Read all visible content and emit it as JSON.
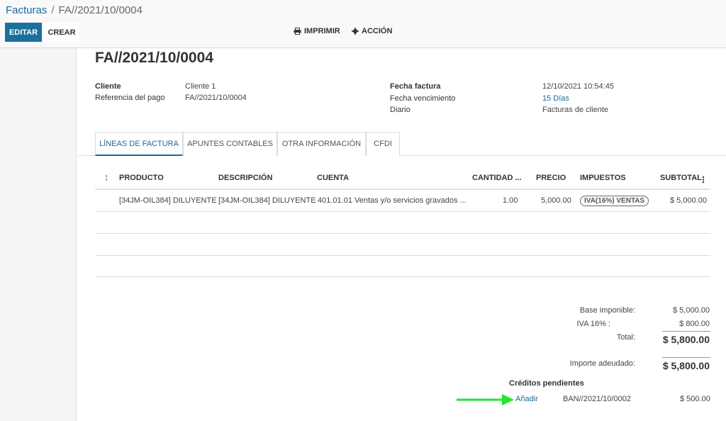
{
  "breadcrumb": {
    "parent": "Facturas",
    "separator": "/",
    "current": "FA//2021/10/0004"
  },
  "toolbar": {
    "edit": "EDITAR",
    "create": "CREAR",
    "print": "IMPRIMIR",
    "action": "ACCIÓN"
  },
  "invoice": {
    "title": "FA//2021/10/0004",
    "left": {
      "client_label": "Cliente",
      "client_value": "Cliente 1",
      "ref_label": "Referencia del pago",
      "ref_value": "FA//2021/10/0004"
    },
    "right": {
      "date_label": "Fecha factura",
      "date_value": "12/10/2021 10:54:45",
      "due_label": "Fecha vencimiento",
      "due_value": "15 Días",
      "journal_label": "Diario",
      "journal_value": "Facturas de cliente"
    }
  },
  "tabs": [
    {
      "label": "LÍNEAS DE FACTURA",
      "active": true
    },
    {
      "label": "APUNTES CONTABLES",
      "active": false
    },
    {
      "label": "OTRA INFORMACIÓN",
      "active": false
    },
    {
      "label": "CFDI",
      "active": false
    }
  ],
  "table": {
    "headers": [
      "PRODUCTO",
      "DESCRIPCIÓN",
      "CUENTA",
      "CANTIDAD ...",
      "PRECIO",
      "IMPUESTOS",
      "SUBTOTAL"
    ],
    "rows": [
      {
        "product": "[34JM-OIL384] DILUYENTE",
        "description": "[34JM-OIL384] DILUYENTE",
        "account": "401.01.01 Ventas y/o servicios gravados ...",
        "quantity": "1.00",
        "price": "5,000.00",
        "tax": "IVA(16%) VENTAS",
        "subtotal": "$ 5,000.00"
      }
    ]
  },
  "totals": {
    "base_label": "Base imponible:",
    "base_value": "$ 5,000.00",
    "iva_label": "IVA 16% :",
    "iva_value": "$ 800.00",
    "total_label": "Total:",
    "total_value": "$ 5,800.00",
    "due_label": "Importe adeudado:",
    "due_value": "$ 5,800.00"
  },
  "credits": {
    "title": "Créditos pendientes",
    "add_label": "Añadir",
    "ref": "BAN//2021/10/0002",
    "amount": "$ 500.00"
  },
  "colors": {
    "primary": "#1b6f9b",
    "link": "#1a6a9a",
    "arrow": "#22e632"
  }
}
